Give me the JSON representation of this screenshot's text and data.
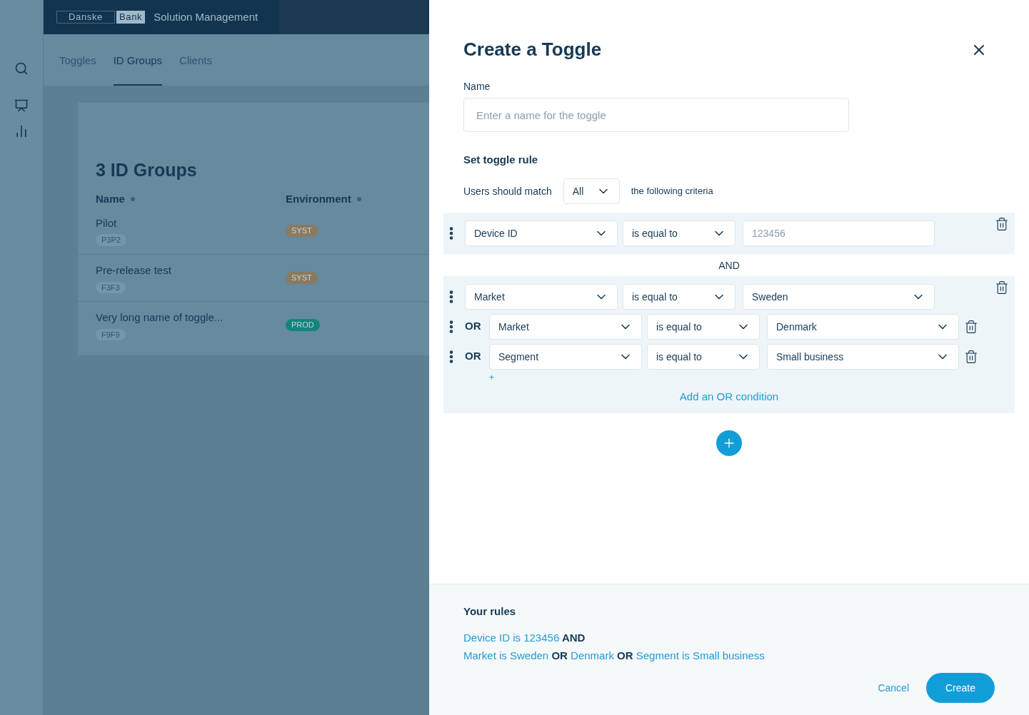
{
  "app": {
    "logo": [
      "Danske",
      "Bank"
    ],
    "title": "Solution Management",
    "tabs": [
      {
        "label": "Toggles",
        "selected": false
      },
      {
        "label": "ID Groups",
        "selected": true
      },
      {
        "label": "Clients",
        "selected": false
      }
    ],
    "heading": "3 ID Groups",
    "columns": [
      "Name",
      "Environment"
    ],
    "rows": [
      {
        "name": "Pilot",
        "code": "P3P2",
        "environment": "SYST",
        "color": "#8a7a5e"
      },
      {
        "name": "Pre-release test",
        "code": "F3F3",
        "environment": "SYST",
        "color": "#8a7a5e"
      },
      {
        "name": "Very long name of toggle...",
        "code": "F9F9",
        "environment": "PROD",
        "color": "#13857c"
      }
    ]
  },
  "dialog": {
    "title": "Create a Toggle",
    "name_label": "Name",
    "name_placeholder": "Enter a name for the toggle",
    "rule_heading": "Set toggle rule",
    "match_prefix": "Users should match",
    "match_value": "All",
    "match_suffix": "the following criteria",
    "groups": [
      {
        "conditions": [
          {
            "field": "Device ID",
            "operator": "is equal to",
            "kind": "input",
            "placeholder": "123456"
          }
        ]
      },
      {
        "join": "AND",
        "conditions": [
          {
            "field": "Market",
            "operator": "is equal to",
            "kind": "select",
            "value": "Sweden"
          },
          {
            "connector": "OR",
            "field": "Market",
            "operator": "is equal to",
            "kind": "select",
            "value": "Denmark"
          },
          {
            "connector": "OR",
            "field": "Segment",
            "operator": "is equal to",
            "kind": "select",
            "value": "Small business"
          }
        ],
        "add_icon": "+",
        "add_link": "Add an OR condition"
      }
    ],
    "summary_heading": "Your rules",
    "summary": [
      [
        {
          "kind": "condition",
          "text": "Device ID is 123456"
        },
        {
          "kind": "operator",
          "text": "AND"
        }
      ],
      [
        {
          "kind": "condition",
          "text": "Market is Sweden"
        },
        {
          "kind": "operator",
          "text": "OR"
        },
        {
          "kind": "condition",
          "text": "Denmark"
        },
        {
          "kind": "operator",
          "text": "OR"
        },
        {
          "kind": "condition",
          "text": "Segment is Small business"
        }
      ]
    ],
    "cancel": "Cancel",
    "create": "Create"
  }
}
